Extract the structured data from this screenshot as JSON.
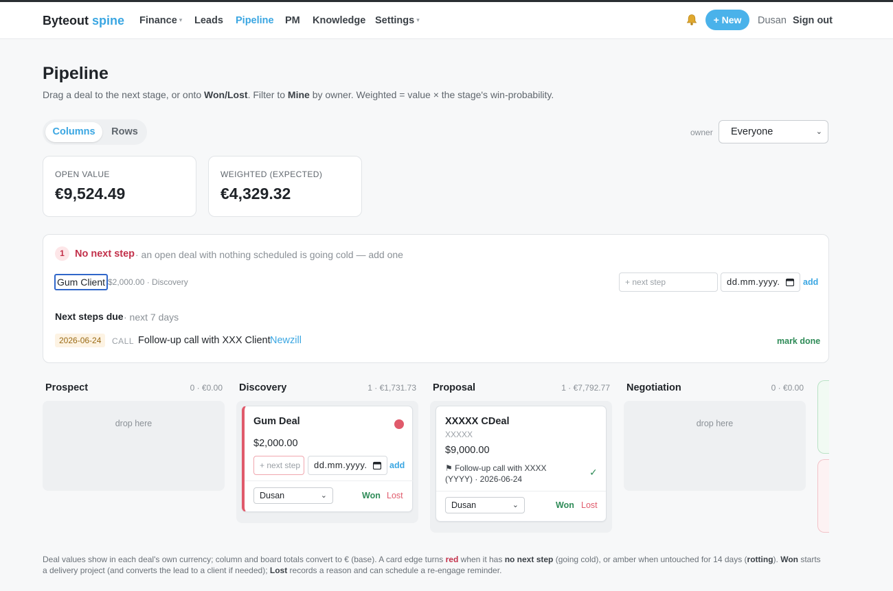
{
  "nav": {
    "brand_a": "Byteout",
    "brand_b": "spine",
    "items": [
      {
        "label": "Finance",
        "dropdown": true
      },
      {
        "label": "Leads",
        "dropdown": false
      },
      {
        "label": "Pipeline",
        "dropdown": false,
        "active": true
      },
      {
        "label": "PM",
        "dropdown": false
      },
      {
        "label": "Knowledge",
        "dropdown": false
      },
      {
        "label": "Settings",
        "dropdown": true
      }
    ],
    "dropdown_glyph": "▾",
    "new_button": "+ New",
    "user": "Dusan",
    "sign_out": "Sign out",
    "bell_icon": "bell-icon"
  },
  "page": {
    "title": "Pipeline",
    "subtitle_1": "Drag a deal to the next stage, or onto ",
    "subtitle_2": "Won/Lost",
    "subtitle_3": ". Filter to ",
    "subtitle_4": "Mine",
    "subtitle_5": " by owner. Weighted = value × the stage's win-probability."
  },
  "view_toggle": {
    "columns": "Columns",
    "rows": "Rows",
    "selected": "Columns"
  },
  "owner_filter": {
    "label": "owner",
    "value": "Everyone"
  },
  "stats": {
    "open_label": "OPEN VALUE",
    "open_value": "€9,524.49",
    "weighted_label": "WEIGHTED (EXPECTED)",
    "weighted_value": "€4,329.32"
  },
  "no_next_step": {
    "count": "1",
    "title": "No next step",
    "description": "· an open deal with nothing scheduled is going cold — add one",
    "deal_name": "Gum Client",
    "deal_meta": "$2,000.00 · Discovery",
    "next_step_placeholder": "+ next step",
    "date_placeholder": "dd.mm.yyyy.",
    "add": "add"
  },
  "next_steps_due": {
    "title": "Next steps due",
    "subtitle": "· next 7 days",
    "items": [
      {
        "date": "2026-06-24",
        "type": "CALL",
        "text": "Follow-up call with XXX Client",
        "client": "Newzill",
        "action": "mark done"
      }
    ]
  },
  "columns": [
    {
      "name": "Prospect",
      "summary": "0 · €0.00",
      "empty_text": "drop here"
    },
    {
      "name": "Discovery",
      "summary": "1 · €1,731.73"
    },
    {
      "name": "Proposal",
      "summary": "1 · €7,792.77"
    },
    {
      "name": "Negotiation",
      "summary": "0 · €0.00",
      "empty_text": "drop here"
    }
  ],
  "cards": {
    "gum_deal": {
      "title": "Gum Deal",
      "amount": "$2,000.00",
      "next_step_placeholder": "+ next step",
      "date_placeholder": "dd.mm.yyyy.",
      "add": "add",
      "owner": "Dusan",
      "won": "Won",
      "lost": "Lost",
      "status_color": "#e05a6b"
    },
    "xxxxx_cdeal": {
      "title": "XXXXX CDeal",
      "subtitle": "XXXXX",
      "amount": "$9,000.00",
      "next_step": "⚑ Follow-up call with XXXX (YYYY) · 2026-06-24",
      "check": "✓",
      "owner": "Dusan",
      "won": "Won",
      "lost": "Lost"
    }
  },
  "footnote": {
    "p1": "Deal values show in each deal's own currency; column and board totals convert to € (base). A card edge turns ",
    "red": "red",
    "p2": " when it has ",
    "no_next_step": "no next step",
    "p3": " (going cold), or amber when untouched for 14 days (",
    "rotting": "rotting",
    "p4": "). ",
    "won": "Won",
    "p5": " starts a delivery project (and converts the lead to a client if needed); ",
    "lost": "Lost",
    "p6": " records a reason and can schedule a re-engage reminder."
  },
  "colors": {
    "accent": "#3aa6e2",
    "danger": "#c2304a",
    "success": "#2e8b57",
    "amber": "#9a6a14"
  }
}
